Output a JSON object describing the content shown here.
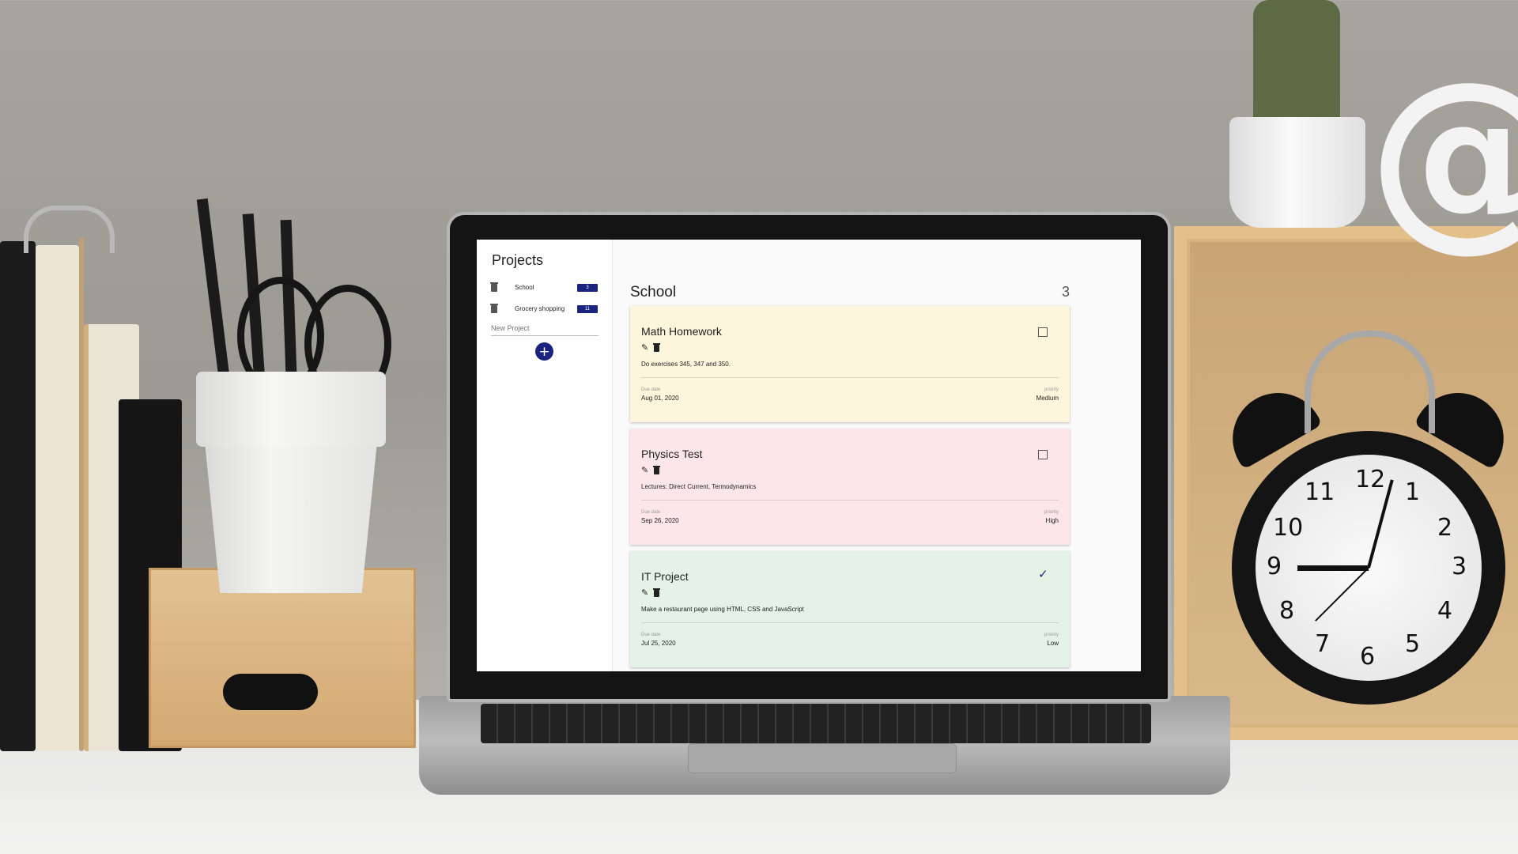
{
  "sidebar": {
    "title": "Projects",
    "projects": [
      {
        "name": "School",
        "count": "3"
      },
      {
        "name": "Grocery shopping",
        "count": "11"
      }
    ],
    "new_project_placeholder": "New Project",
    "add_label": "+"
  },
  "main": {
    "title": "School",
    "count": "3",
    "due_label": "Due date",
    "priority_label": "priority",
    "tasks": [
      {
        "title": "Math Homework",
        "description": "Do exercises 345, 347 and 350.",
        "due": "Aug 01, 2020",
        "priority": "Medium",
        "done": false,
        "color": "#fdf5dc"
      },
      {
        "title": "Physics Test",
        "description": "Lectures: Direct Current, Termodynamics",
        "due": "Sep 26, 2020",
        "priority": "High",
        "done": false,
        "color": "#fde6e9"
      },
      {
        "title": "IT Project",
        "description": "Make a restaurant page using HTML, CSS and JavaScript",
        "due": "Jul 25, 2020",
        "priority": "Low",
        "done": true,
        "color": "#e4f3e6"
      }
    ]
  },
  "icons": {
    "delete": "trash-icon",
    "edit": "pencil-icon",
    "checked": "check-icon",
    "unchecked": "checkbox-icon",
    "add": "plus-icon"
  },
  "colors": {
    "accent": "#1a237e"
  },
  "clock": {
    "numbers": [
      "12",
      "1",
      "2",
      "3",
      "4",
      "5",
      "6",
      "7",
      "8",
      "9",
      "10",
      "11"
    ]
  },
  "decor": {
    "at_sign": "@"
  }
}
